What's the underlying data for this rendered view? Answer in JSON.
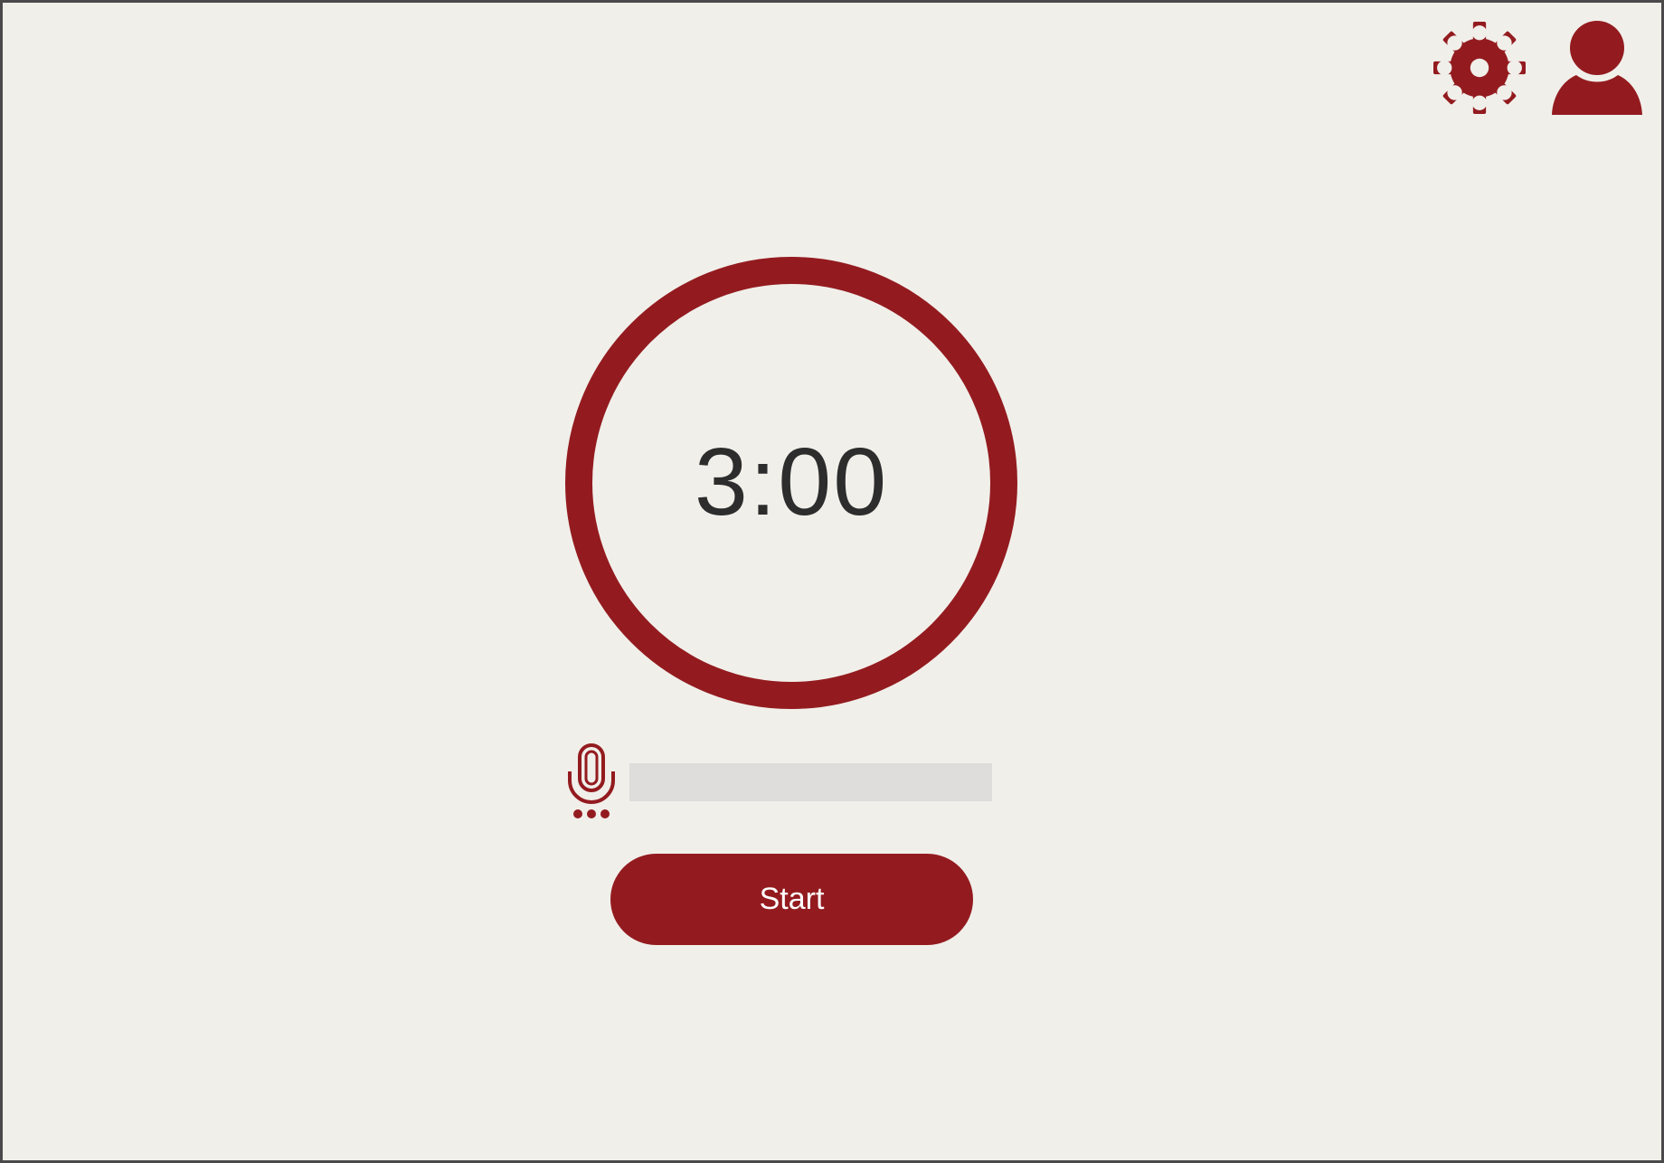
{
  "header": {
    "settings_icon": "gear-icon",
    "profile_icon": "user-icon"
  },
  "timer": {
    "display": "3:00"
  },
  "voice": {
    "mic_icon": "microphone-icon",
    "input_value": "",
    "placeholder": ""
  },
  "controls": {
    "start_label": "Start"
  },
  "colors": {
    "accent": "#931b1f",
    "background": "#f1efea",
    "text": "#2d2d2d",
    "input_bg": "#dedddb"
  }
}
